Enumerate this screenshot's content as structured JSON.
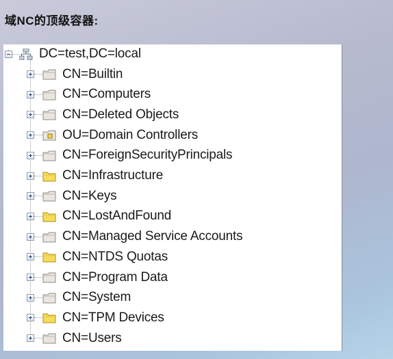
{
  "heading": "域NC的顶级容器:",
  "tree": {
    "root": {
      "label": "DC=test,DC=local",
      "icon": "domain-icon"
    },
    "children": [
      {
        "label": "CN=Builtin",
        "icon": "container-icon"
      },
      {
        "label": "CN=Computers",
        "icon": "container-icon"
      },
      {
        "label": "CN=Deleted Objects",
        "icon": "container-icon"
      },
      {
        "label": "OU=Domain Controllers",
        "icon": "ou-icon"
      },
      {
        "label": "CN=ForeignSecurityPrincipals",
        "icon": "container-icon"
      },
      {
        "label": "CN=Infrastructure",
        "icon": "folder-icon"
      },
      {
        "label": "CN=Keys",
        "icon": "container-icon"
      },
      {
        "label": "CN=LostAndFound",
        "icon": "folder-icon"
      },
      {
        "label": "CN=Managed Service Accounts",
        "icon": "container-icon"
      },
      {
        "label": "CN=NTDS Quotas",
        "icon": "folder-icon"
      },
      {
        "label": "CN=Program Data",
        "icon": "container-icon"
      },
      {
        "label": "CN=System",
        "icon": "container-icon"
      },
      {
        "label": "CN=TPM Devices",
        "icon": "folder-icon"
      },
      {
        "label": "CN=Users",
        "icon": "container-icon"
      }
    ]
  },
  "colors": {
    "folder": "#f5dc5a",
    "container": "#e8e6df",
    "background_top": "#c9cbdb",
    "background_bottom": "#b5d4e8"
  }
}
